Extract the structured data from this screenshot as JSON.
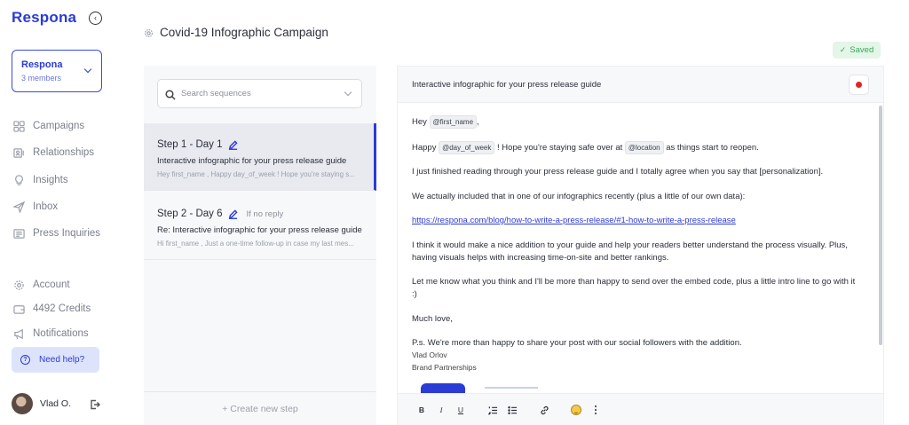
{
  "app": {
    "logo": "Respona",
    "collapse_icon": "chevron-left-circle-icon"
  },
  "team": {
    "name": "Respona",
    "members": "3 members"
  },
  "nav": {
    "primary": [
      {
        "label": "Campaigns",
        "icon": "grid-icon"
      },
      {
        "label": "Relationships",
        "icon": "contacts-icon"
      },
      {
        "label": "Insights",
        "icon": "lightbulb-icon"
      },
      {
        "label": "Inbox",
        "icon": "send-icon"
      },
      {
        "label": "Press Inquiries",
        "icon": "newspaper-icon"
      }
    ],
    "secondary": [
      {
        "label": "Account",
        "icon": "gear-icon"
      },
      {
        "label": "4492 Credits",
        "icon": "wallet-icon"
      },
      {
        "label": "Notifications",
        "icon": "megaphone-icon"
      }
    ],
    "help_label": "Need help?"
  },
  "user": {
    "name": "Vlad O."
  },
  "page": {
    "title": "Covid-19 Infographic Campaign",
    "saved_label": "Saved"
  },
  "sequences": {
    "search_placeholder": "Search sequences",
    "steps": [
      {
        "title": "Step 1 - Day 1",
        "condition": "",
        "subject": "Interactive infographic for your press release guide",
        "preview": "Hey first_name , Happy day_of_week ! Hope you're staying s...",
        "active": true
      },
      {
        "title": "Step 2 - Day 6",
        "condition": "If no reply",
        "subject": "Re: Interactive infographic for your press release guide",
        "preview": "Hi first_name , Just a one-time follow-up in case my last mes...",
        "active": false
      }
    ],
    "create_label": "+ Create new step"
  },
  "editor": {
    "subject": "Interactive infographic for your press release guide",
    "greeting_prefix": "Hey",
    "var_first_name": "@first_name",
    "greeting_suffix": ",",
    "p1_prefix": "Happy",
    "var_day_of_week": "@day_of_week",
    "p1_mid": "! Hope you're staying safe over at",
    "var_location": "@location",
    "p1_suffix": "as things start to reopen.",
    "p2": "I just finished reading through your press release guide and I totally agree when you say that [personalization].",
    "p3": "We actually included that in one of our infographics recently (plus a little of our own data):",
    "link": "https://respona.com/blog/how-to-write-a-press-release/#1-how-to-write-a-press-release",
    "p4": "I think it would make a nice addition to your guide and help your readers better understand the process visually. Plus, having visuals helps with increasing time-on-site and better rankings.",
    "p5": "Let me know what you think and I'll be more than happy to send over the embed code, plus a little intro line to go with it :)",
    "p6": "Much love,",
    "p7": "P.s. We're more than happy to share your post with our social followers with the addition.",
    "sig_name": "Vlad Orlov",
    "sig_title": "Brand Partnerships",
    "toolbar": [
      "bold-icon",
      "italic-icon",
      "underline-icon",
      "ordered-list-icon",
      "bullet-list-icon",
      "link-icon",
      "emoji-icon",
      "more-icon"
    ]
  }
}
